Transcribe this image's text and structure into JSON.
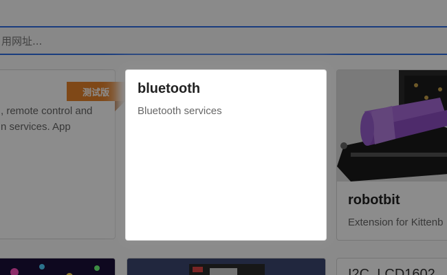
{
  "search": {
    "placeholder": "用网址..."
  },
  "cards": [
    {
      "title": "",
      "description": "..., remote control and ... services. App",
      "badge": "测试版"
    },
    {
      "title": "bluetooth",
      "description": "Bluetooth services"
    },
    {
      "title": "robotbit",
      "description": "Extension for Kittenb"
    },
    {
      "title": "",
      "description": ""
    },
    {
      "title": "",
      "description": ""
    },
    {
      "title": "I2C_LCD1602",
      "description": ""
    }
  ],
  "colors": {
    "accent": "#2e6ee6",
    "badge": "#e8832a",
    "battery": "#a86ad9"
  }
}
